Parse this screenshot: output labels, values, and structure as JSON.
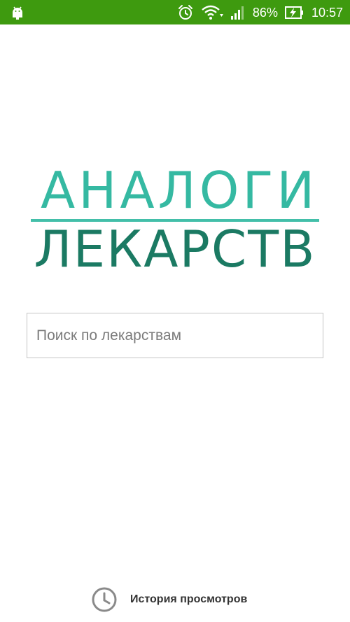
{
  "status_bar": {
    "battery_percent": "86%",
    "time": "10:57",
    "background_color": "#3e9a0f",
    "icons": [
      "android-icon",
      "alarm-icon",
      "wifi-icon",
      "signal-icon",
      "battery-charging-icon"
    ]
  },
  "logo": {
    "line1": "АНАЛОГИ",
    "line2": "ЛЕКАРСТВ",
    "line1_color": "#35b9a2",
    "line2_color": "#1b7a63"
  },
  "search": {
    "placeholder": "Поиск по лекарствам",
    "value": ""
  },
  "history": {
    "label": "История просмотров",
    "icon": "clock-icon"
  }
}
